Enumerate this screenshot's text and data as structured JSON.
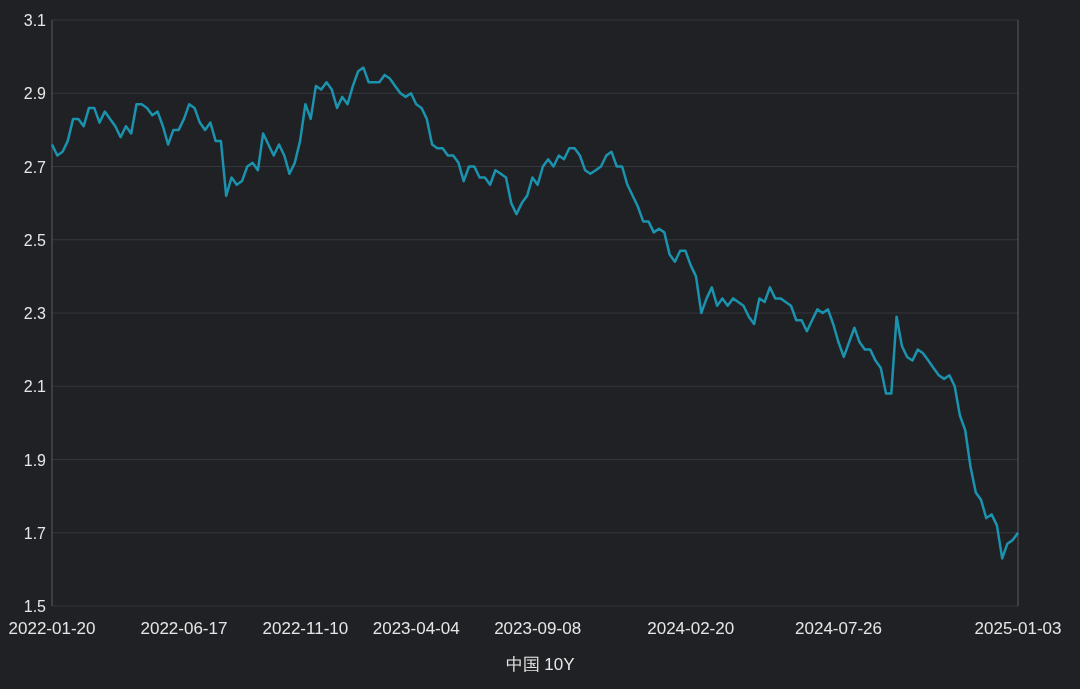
{
  "chart": {
    "chart_data": {
      "type": "line",
      "categories": [
        "2022-01-20",
        null,
        null,
        null,
        null,
        null,
        null,
        null,
        null,
        null,
        null,
        null,
        null,
        null,
        null,
        null,
        null,
        null,
        null,
        null,
        null,
        null,
        null,
        null,
        null,
        "2022-06-17",
        null,
        null,
        null,
        null,
        null,
        null,
        null,
        null,
        null,
        null,
        null,
        null,
        null,
        null,
        null,
        null,
        null,
        null,
        null,
        null,
        null,
        null,
        "2022-11-10",
        null,
        null,
        null,
        null,
        null,
        null,
        null,
        null,
        null,
        null,
        null,
        null,
        null,
        null,
        null,
        null,
        null,
        null,
        null,
        null,
        "2023-04-04",
        null,
        null,
        null,
        null,
        null,
        null,
        null,
        null,
        null,
        null,
        null,
        null,
        null,
        null,
        null,
        null,
        null,
        null,
        null,
        null,
        null,
        null,
        "2023-09-08",
        null,
        null,
        null,
        null,
        null,
        null,
        null,
        null,
        null,
        null,
        null,
        null,
        null,
        null,
        null,
        null,
        null,
        null,
        null,
        null,
        null,
        null,
        null,
        null,
        null,
        null,
        null,
        null,
        "2024-02-20",
        null,
        null,
        null,
        null,
        null,
        null,
        null,
        null,
        null,
        null,
        null,
        null,
        null,
        null,
        null,
        null,
        null,
        null,
        null,
        null,
        null,
        null,
        null,
        null,
        null,
        null,
        null,
        "2024-07-26",
        null,
        null,
        null,
        null,
        null,
        null,
        null,
        null,
        null,
        null,
        null,
        null,
        null,
        null,
        null,
        null,
        null,
        null,
        null,
        null,
        null,
        null,
        null,
        null,
        null,
        null,
        null,
        null,
        null,
        null,
        null,
        null,
        null,
        "2025-01-03"
      ],
      "series": [
        {
          "name": "中国 10Y",
          "color": "#1b93ae",
          "values": [
            2.76,
            2.73,
            2.74,
            2.77,
            2.83,
            2.83,
            2.81,
            2.86,
            2.86,
            2.82,
            2.85,
            2.83,
            2.81,
            2.78,
            2.81,
            2.79,
            2.87,
            2.87,
            2.86,
            2.84,
            2.85,
            2.81,
            2.76,
            2.8,
            2.8,
            2.83,
            2.87,
            2.86,
            2.82,
            2.8,
            2.82,
            2.77,
            2.77,
            2.62,
            2.67,
            2.65,
            2.66,
            2.7,
            2.71,
            2.69,
            2.79,
            2.76,
            2.73,
            2.76,
            2.73,
            2.68,
            2.71,
            2.77,
            2.87,
            2.83,
            2.92,
            2.91,
            2.93,
            2.91,
            2.86,
            2.89,
            2.87,
            2.92,
            2.96,
            2.97,
            2.93,
            2.93,
            2.93,
            2.95,
            2.94,
            2.92,
            2.9,
            2.89,
            2.9,
            2.87,
            2.86,
            2.83,
            2.76,
            2.75,
            2.75,
            2.73,
            2.73,
            2.71,
            2.66,
            2.7,
            2.7,
            2.67,
            2.67,
            2.65,
            2.69,
            2.68,
            2.67,
            2.6,
            2.57,
            2.6,
            2.62,
            2.67,
            2.65,
            2.7,
            2.72,
            2.7,
            2.73,
            2.72,
            2.75,
            2.75,
            2.73,
            2.69,
            2.68,
            2.69,
            2.7,
            2.73,
            2.74,
            2.7,
            2.7,
            2.65,
            2.62,
            2.59,
            2.55,
            2.55,
            2.52,
            2.53,
            2.52,
            2.46,
            2.44,
            2.47,
            2.47,
            2.43,
            2.4,
            2.3,
            2.34,
            2.37,
            2.32,
            2.34,
            2.32,
            2.34,
            2.33,
            2.32,
            2.29,
            2.27,
            2.34,
            2.33,
            2.37,
            2.34,
            2.34,
            2.33,
            2.32,
            2.28,
            2.28,
            2.25,
            2.28,
            2.31,
            2.3,
            2.31,
            2.27,
            2.22,
            2.18,
            2.22,
            2.26,
            2.22,
            2.2,
            2.2,
            2.17,
            2.15,
            2.08,
            2.08,
            2.29,
            2.21,
            2.18,
            2.17,
            2.2,
            2.19,
            2.17,
            2.15,
            2.13,
            2.12,
            2.13,
            2.1,
            2.02,
            1.98,
            1.88,
            1.81,
            1.79,
            1.74,
            1.75,
            1.72,
            1.63,
            1.67,
            1.68,
            1.7
          ]
        }
      ],
      "grid": true,
      "ylim": [
        1.5,
        3.1
      ],
      "yticks": [
        1.5,
        1.7,
        1.9,
        2.1,
        2.3,
        2.5,
        2.7,
        2.9,
        3.1
      ]
    }
  }
}
